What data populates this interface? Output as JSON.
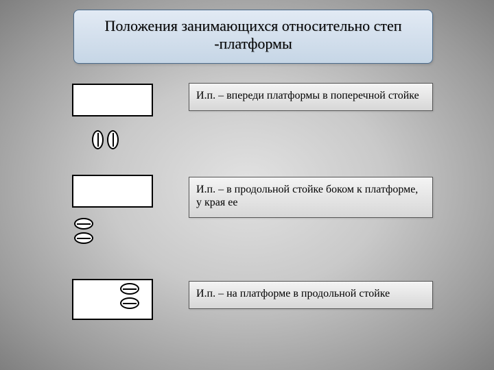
{
  "title": "Положения занимающихся относительно степ -платформы",
  "rows": [
    {
      "description": "И.п. – впереди платформы в поперечной стойке"
    },
    {
      "description": "И.п. – в продольной стойке боком к платформе, у края ее"
    },
    {
      "description": "И.п. – на платформе в продольной стойке"
    }
  ]
}
